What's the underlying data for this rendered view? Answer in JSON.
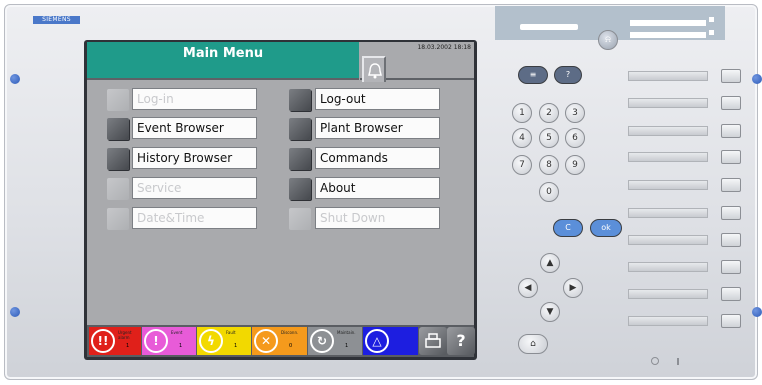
{
  "brand": "SIEMENS",
  "screen": {
    "title": "Main Menu",
    "datetime": "18.03.2002 18:18",
    "bell_icon": "bell-icon"
  },
  "menu": {
    "left": [
      {
        "label": "Log-in",
        "enabled": false
      },
      {
        "label": "Event Browser",
        "enabled": true
      },
      {
        "label": "History Browser",
        "enabled": true
      },
      {
        "label": "Service",
        "enabled": false
      },
      {
        "label": "Date&Time",
        "enabled": false
      }
    ],
    "right": [
      {
        "label": "Log-out",
        "enabled": true
      },
      {
        "label": "Plant Browser",
        "enabled": true
      },
      {
        "label": "Commands",
        "enabled": true
      },
      {
        "label": "About",
        "enabled": true
      },
      {
        "label": "Shut Down",
        "enabled": false
      }
    ]
  },
  "status": [
    {
      "name": "alarm",
      "icon": "!!",
      "color": "#e0201a",
      "text": "Urgent alarm",
      "count": "1"
    },
    {
      "name": "fault",
      "icon": "!",
      "color": "#e85bd8",
      "text": "Event",
      "count": "1"
    },
    {
      "name": "lightning",
      "icon": "ϟ",
      "color": "#f2d900",
      "text": "Fault",
      "count": "1"
    },
    {
      "name": "cross",
      "icon": "✕",
      "color": "#f59a1c",
      "text": "Disconn.",
      "count": "0"
    },
    {
      "name": "maintenance",
      "icon": "↻",
      "color": "#8d9094",
      "text": "Maintain.",
      "count": "1"
    },
    {
      "name": "warning",
      "icon": "△",
      "color": "#1d1ee0",
      "text": "",
      "count": ""
    }
  ],
  "keypad": {
    "top": [
      "≡",
      "?"
    ],
    "digits": [
      "1",
      "2",
      "3",
      "4",
      "5",
      "6",
      "7",
      "8",
      "9",
      "0"
    ],
    "actions": {
      "cancel": "C",
      "ok": "ok"
    },
    "arrows": [
      "▲",
      "◀",
      "▶",
      "▼"
    ]
  },
  "colors": {
    "title_teal": "#1f9b8a",
    "pill_blue": "#5b8fd9"
  },
  "fkeys_count": 10
}
